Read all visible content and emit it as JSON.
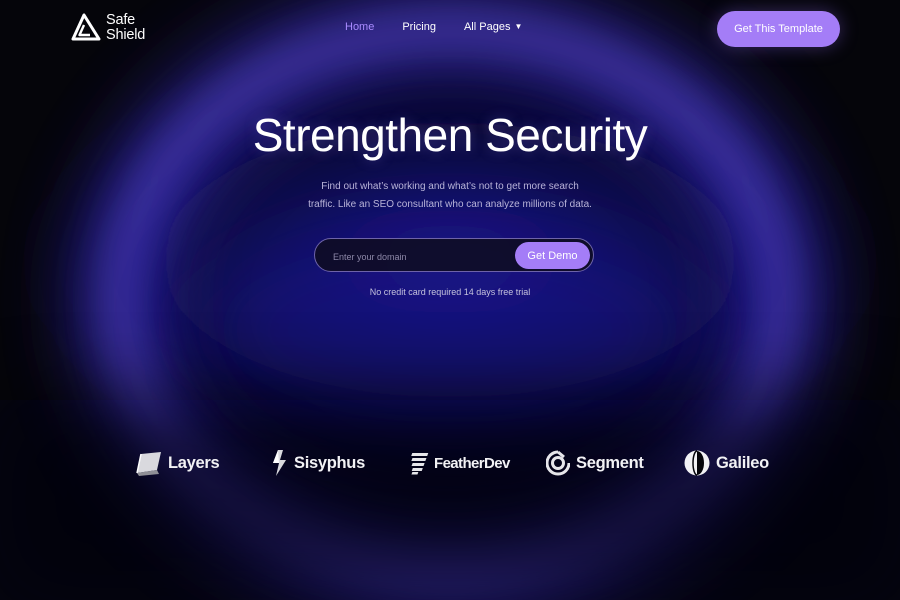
{
  "brand": {
    "name_line1": "Safe",
    "name_line2": "Shield",
    "accent_color": "#a47df7",
    "glow_color": "#4b3ee8"
  },
  "nav": {
    "items": [
      {
        "label": "Home",
        "active": true
      },
      {
        "label": "Pricing",
        "active": false
      },
      {
        "label": "All Pages",
        "active": false,
        "has_dropdown": true
      }
    ],
    "cta_label": "Get This Template"
  },
  "hero": {
    "title": "Strengthen Security",
    "subtitle_line1": "Find out what’s working and what’s not to get more search",
    "subtitle_line2": "traffic. Like an SEO consultant who can analyze millions of data.",
    "input_placeholder": "Enter your domain",
    "input_value": "",
    "button_label": "Get Demo",
    "note": "No credit card required 14 days free trial"
  },
  "partners": [
    {
      "name": "Layers",
      "icon": "layers-icon"
    },
    {
      "name": "Sisyphus",
      "icon": "bolt-icon"
    },
    {
      "name": "FeatherDev",
      "icon": "feather-icon"
    },
    {
      "name": "Segment",
      "icon": "segment-icon"
    },
    {
      "name": "Galileo",
      "icon": "galileo-icon"
    }
  ]
}
